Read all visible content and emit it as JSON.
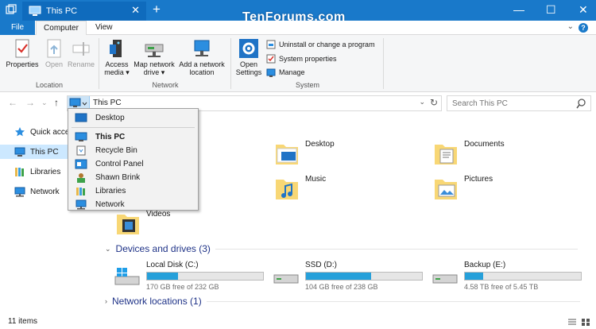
{
  "window": {
    "tab_title": "This PC",
    "watermark": "TenForums.com",
    "new_tab": "+",
    "minimize": "—",
    "maximize": "☐",
    "close": "✕",
    "tab_close": "✕"
  },
  "ribbon_tabs": {
    "file": "File",
    "computer": "Computer",
    "view": "View",
    "help": "?"
  },
  "ribbon": {
    "location": {
      "group": "Location",
      "properties": "Properties",
      "open": "Open",
      "rename": "Rename"
    },
    "network": {
      "group": "Network",
      "access_media": [
        "Access",
        "media ▾"
      ],
      "map_drive": [
        "Map network",
        "drive ▾"
      ],
      "add_location": [
        "Add a network",
        "location"
      ]
    },
    "system": {
      "group": "System",
      "open_settings": [
        "Open",
        "Settings"
      ],
      "uninstall": "Uninstall or change a program",
      "sys_props": "System properties",
      "manage": "Manage"
    }
  },
  "address": {
    "path": "This PC",
    "search_placeholder": "Search This PC"
  },
  "nav_pane": [
    {
      "label": "Quick access",
      "icon": "star-icon"
    },
    {
      "label": "This PC",
      "icon": "computer-icon",
      "selected": true
    },
    {
      "label": "Libraries",
      "icon": "libraries-icon"
    },
    {
      "label": "Network",
      "icon": "network-icon"
    }
  ],
  "dropdown": {
    "desktop": "Desktop",
    "this_pc": "This PC",
    "recycle_bin": "Recycle Bin",
    "control_panel": "Control Panel",
    "user": "Shawn Brink",
    "libraries": "Libraries",
    "network": "Network"
  },
  "folders": {
    "desktop": "Desktop",
    "documents": "Documents",
    "music": "Music",
    "pictures": "Pictures",
    "videos": "Videos"
  },
  "devices_group": "Devices and drives (3)",
  "drives": [
    {
      "name": "Local Disk (C:)",
      "free": "170 GB free of 232 GB",
      "used_fraction": 0.27
    },
    {
      "name": "SSD (D:)",
      "free": "104 GB free of 238 GB",
      "used_fraction": 0.56
    },
    {
      "name": "Backup (E:)",
      "free": "4.58 TB free of 5.45 TB",
      "used_fraction": 0.16
    }
  ],
  "network_group": "Network locations (1)",
  "status": {
    "items": "11 items"
  },
  "colors": {
    "accent": "#1979ca",
    "selection": "#cce8ff",
    "drive_bar": "#26a0da",
    "group_header": "#1e3287"
  }
}
